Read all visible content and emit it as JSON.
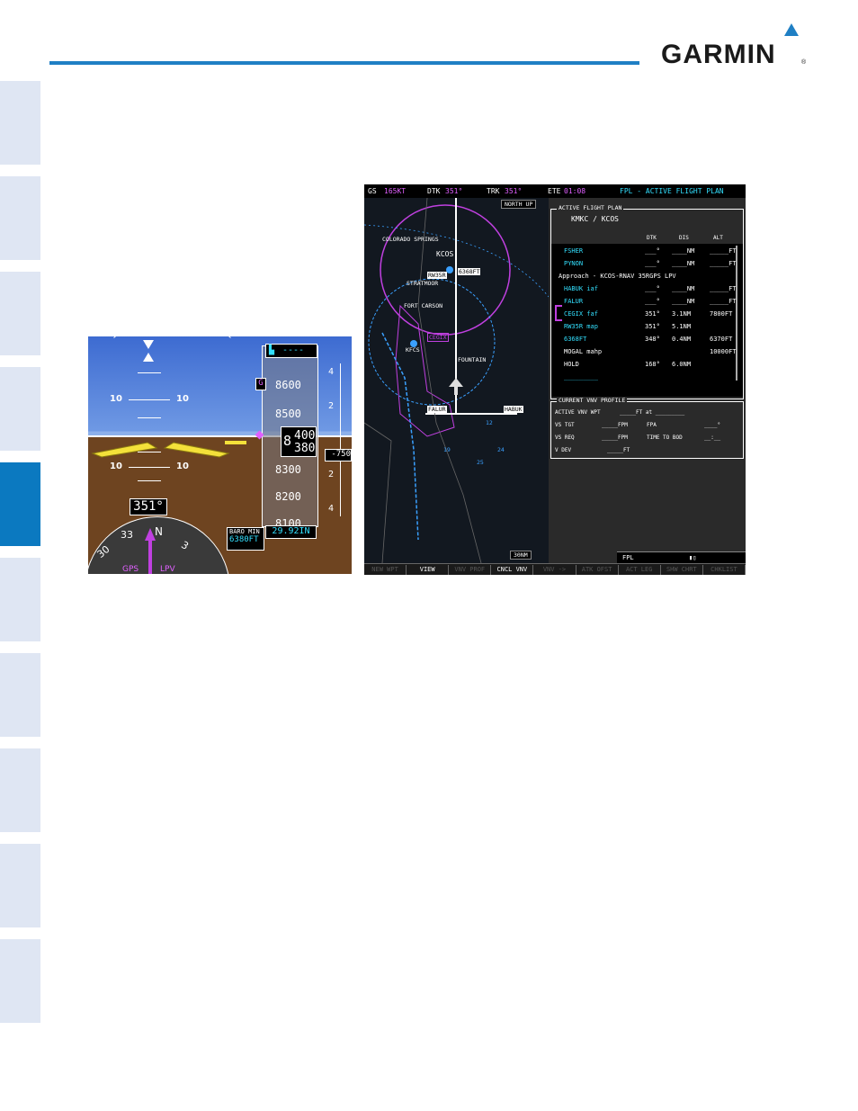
{
  "brand": {
    "name": "GARMIN",
    "reg": "®"
  },
  "pfd": {
    "pitch_labels": [
      "10",
      "10",
      "10",
      "10"
    ],
    "alt_selected": "----",
    "alt_marker": "G",
    "alt_ticks": [
      "8600",
      "8500",
      "8300",
      "8200",
      "8100"
    ],
    "alt_current_big": "8",
    "alt_current_hi": "400",
    "alt_current_lo": "380",
    "vsi_ticks": [
      "4",
      "2",
      "2",
      "4"
    ],
    "vsi_value": "-750",
    "heading": "351°",
    "baro_min_label": "BARO MIN",
    "baro_min_value": "6380FT",
    "baro_setting": "29.92IN",
    "compass": [
      "30",
      "33",
      "N",
      "3"
    ],
    "gps_label": "GPS",
    "lpv_label": "LPV"
  },
  "mfd": {
    "topbar": {
      "gs_label": "GS",
      "gs_value": "165KT",
      "dtk_label": "DTK",
      "dtk_value": "351°",
      "trk_label": "TRK",
      "trk_value": "351°",
      "ete_label": "ETE",
      "ete_value": "01:08",
      "page_title": "FPL - ACTIVE FLIGHT PLAN"
    },
    "map": {
      "north_up": "NORTH UP",
      "range": "30NM",
      "labels": [
        "COLORADO SPRINGS",
        "KCOS",
        "RW35R",
        "6368FT",
        "STRATMOOR",
        "FORT CARSON",
        "CEGIX",
        "KFCS",
        "FOUNTAIN",
        "FALUR",
        "HABUK",
        "12",
        "19",
        "24",
        "25"
      ]
    },
    "afp": {
      "title": "ACTIVE FLIGHT PLAN",
      "route": "KMKC / KCOS",
      "col_dtk": "DTK",
      "col_dis": "DIS",
      "col_alt": "ALT",
      "rows": [
        {
          "wpt": "FSHER",
          "dtk": "___°",
          "dis": "____NM",
          "alt": "_____FT"
        },
        {
          "wpt": "PYNON",
          "dtk": "___°",
          "dis": "____NM",
          "alt": "_____FT"
        },
        {
          "wpt": "Approach - KCOS-RNAV 35RGPS LPV",
          "dtk": "",
          "dis": "",
          "alt": ""
        },
        {
          "wpt": "HABUK iaf",
          "dtk": "___°",
          "dis": "____NM",
          "alt": "_____FT"
        },
        {
          "wpt": "FALUR",
          "dtk": "___°",
          "dis": "____NM",
          "alt": "_____FT"
        },
        {
          "wpt": "CEGIX faf",
          "dtk": "351°",
          "dis": "3.1NM",
          "alt": "7800FT"
        },
        {
          "wpt": "RW35R map",
          "dtk": "351°",
          "dis": "5.1NM",
          "alt": ""
        },
        {
          "wpt": "6368FT",
          "dtk": "348°",
          "dis": "0.4NM",
          "alt": "6370FT"
        },
        {
          "wpt": "MOGAL mahp",
          "dtk": "",
          "dis": "",
          "alt": "10000FT"
        },
        {
          "wpt": "HOLD",
          "dtk": "168°",
          "dis": "6.0NM",
          "alt": ""
        },
        {
          "wpt": "_________",
          "dtk": "",
          "dis": "",
          "alt": ""
        }
      ]
    },
    "vnv": {
      "title": "CURRENT VNV PROFILE",
      "active_wpt_label": "ACTIVE VNV WPT",
      "active_wpt_value": "_____FT  at  _________",
      "vs_tgt_label": "VS TGT",
      "vs_tgt_value": "_____FPM",
      "fpa_label": "FPA",
      "fpa_value": "____°",
      "vs_req_label": "VS REQ",
      "vs_req_value": "_____FPM",
      "tod_label": "TIME TO BOD",
      "tod_value": "__:__",
      "vdev_label": "V DEV",
      "vdev_value": "_____FT"
    },
    "status_bar": {
      "left": "FPL",
      "right": "▮▯"
    },
    "softkeys": [
      {
        "label": "NEW WPT",
        "on": false
      },
      {
        "label": "VIEW",
        "on": true
      },
      {
        "label": "VNV PROF",
        "on": false
      },
      {
        "label": "CNCL VNV",
        "on": true
      },
      {
        "label": "VNV ->",
        "on": false
      },
      {
        "label": "ATK OFST",
        "on": false
      },
      {
        "label": "ACT LEG",
        "on": false
      },
      {
        "label": "SHW CHRT",
        "on": false
      },
      {
        "label": "CHKLIST",
        "on": false
      }
    ]
  }
}
